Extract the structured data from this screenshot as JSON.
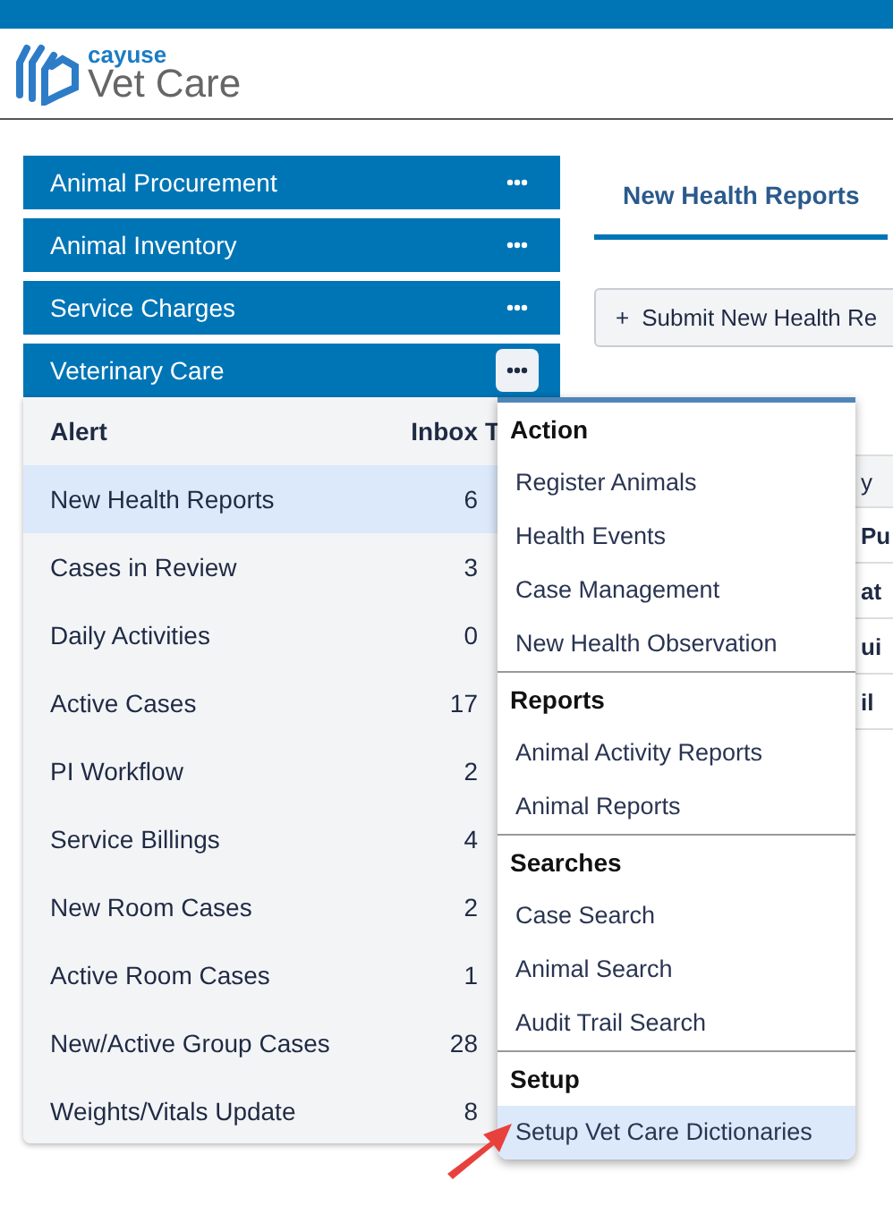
{
  "logo": {
    "brand": "cayuse",
    "product": "Vet Care"
  },
  "modules": [
    {
      "label": "Animal Procurement",
      "expanded": false
    },
    {
      "label": "Animal Inventory",
      "expanded": false
    },
    {
      "label": "Service Charges",
      "expanded": false
    },
    {
      "label": "Veterinary Care",
      "expanded": true
    }
  ],
  "alerts": {
    "columns": [
      "Alert",
      "Inbox",
      "T"
    ],
    "rows": [
      {
        "name": "New Health Reports",
        "inbox": "6",
        "selected": true
      },
      {
        "name": "Cases in Review",
        "inbox": "3",
        "selected": false
      },
      {
        "name": "Daily Activities",
        "inbox": "0",
        "selected": false
      },
      {
        "name": "Active Cases",
        "inbox": "17",
        "selected": false
      },
      {
        "name": "PI Workflow",
        "inbox": "2",
        "selected": false
      },
      {
        "name": "Service Billings",
        "inbox": "4",
        "selected": false
      },
      {
        "name": "New Room Cases",
        "inbox": "2",
        "selected": false
      },
      {
        "name": "Active Room Cases",
        "inbox": "1",
        "selected": false
      },
      {
        "name": "New/Active Group Cases",
        "inbox": "28",
        "selected": false
      },
      {
        "name": "Weights/Vitals Update",
        "inbox": "8",
        "selected": false
      }
    ]
  },
  "tabs": [
    {
      "label": "New Health Reports",
      "selected": true
    }
  ],
  "submit_button": {
    "icon": "+",
    "label": "Submit New Health Re"
  },
  "records_table": {
    "header": "y",
    "rows": [
      "Pu",
      "at",
      "ui",
      "il"
    ]
  },
  "menu": {
    "sections": [
      {
        "title": "Action",
        "items": [
          {
            "label": "Register Animals",
            "selected": false
          },
          {
            "label": "Health Events",
            "selected": false
          },
          {
            "label": "Case Management",
            "selected": false
          },
          {
            "label": "New Health Observation",
            "selected": false
          }
        ]
      },
      {
        "title": "Reports",
        "items": [
          {
            "label": "Animal Activity Reports",
            "selected": false
          },
          {
            "label": "Animal Reports",
            "selected": false
          }
        ]
      },
      {
        "title": "Searches",
        "items": [
          {
            "label": "Case Search",
            "selected": false
          },
          {
            "label": "Animal Search",
            "selected": false
          },
          {
            "label": "Audit Trail Search",
            "selected": false
          }
        ]
      },
      {
        "title": "Setup",
        "items": [
          {
            "label": "Setup Vet Care Dictionaries",
            "selected": true
          }
        ]
      }
    ]
  }
}
